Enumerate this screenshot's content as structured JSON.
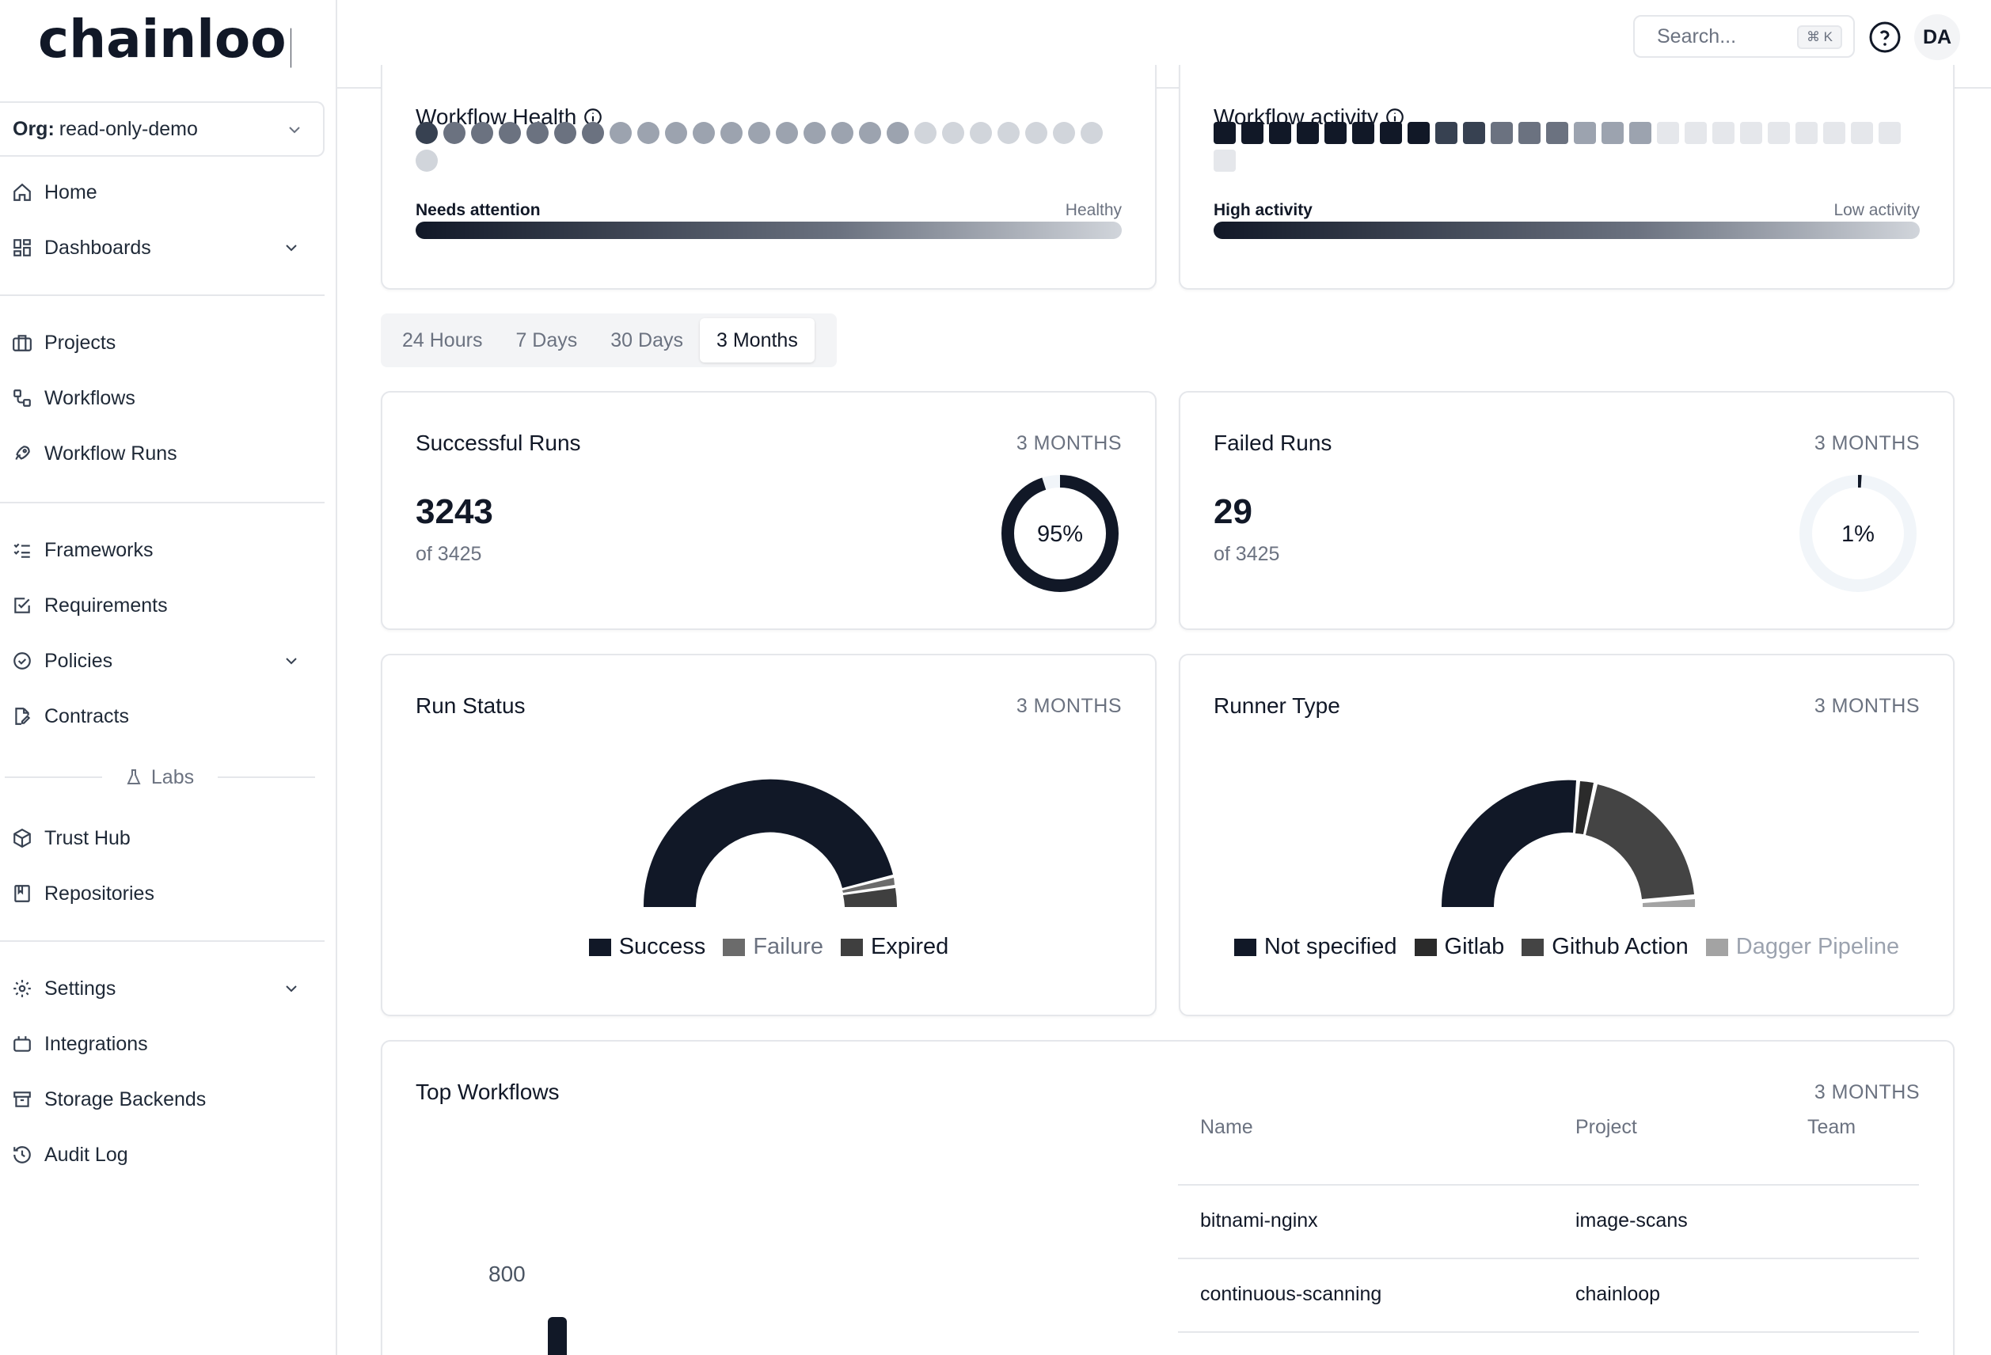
{
  "app": {
    "logo_text": "chainloop"
  },
  "sidebar": {
    "org_label": "Org:",
    "org_value": "read-only-demo",
    "items": {
      "home": "Home",
      "dashboards": "Dashboards",
      "projects": "Projects",
      "workflows": "Workflows",
      "workflow_runs": "Workflow Runs",
      "frameworks": "Frameworks",
      "requirements": "Requirements",
      "policies": "Policies",
      "contracts": "Contracts",
      "labs": "Labs",
      "trust_hub": "Trust Hub",
      "repositories": "Repositories",
      "settings": "Settings",
      "integrations": "Integrations",
      "storage_backends": "Storage Backends",
      "audit_log": "Audit Log"
    }
  },
  "topbar": {
    "search_placeholder": "Search...",
    "search_shortcut": "⌘ K",
    "avatar_initials": "DA"
  },
  "health": {
    "title": "Workflow Health",
    "low_label": "Needs attention",
    "high_label": "Healthy",
    "dot_colors": [
      "#374151",
      "#6b7280",
      "#6b7280",
      "#6b7280",
      "#6b7280",
      "#6b7280",
      "#6b7280",
      "#9ca3af",
      "#9ca3af",
      "#9ca3af",
      "#9ca3af",
      "#9ca3af",
      "#9ca3af",
      "#9ca3af",
      "#9ca3af",
      "#9ca3af",
      "#9ca3af",
      "#9ca3af",
      "#d1d5db",
      "#d1d5db",
      "#d1d5db",
      "#d1d5db",
      "#d1d5db",
      "#d1d5db",
      "#d1d5db",
      "#d1d5db"
    ]
  },
  "activity": {
    "title": "Workflow activity",
    "high_label": "High activity",
    "low_label": "Low activity",
    "square_colors": [
      "#111827",
      "#111827",
      "#111827",
      "#111827",
      "#111827",
      "#111827",
      "#111827",
      "#111827",
      "#374151",
      "#374151",
      "#6b7280",
      "#6b7280",
      "#6b7280",
      "#9ca3af",
      "#9ca3af",
      "#9ca3af",
      "#e5e7eb",
      "#e5e7eb",
      "#e5e7eb",
      "#e5e7eb",
      "#e5e7eb",
      "#e5e7eb",
      "#e5e7eb",
      "#e5e7eb",
      "#e5e7eb",
      "#e5e7eb"
    ]
  },
  "tabs": [
    "24 Hours",
    "7 Days",
    "30 Days",
    "3 Months"
  ],
  "active_tab": "3 Months",
  "successful_runs": {
    "title": "Successful Runs",
    "period": "3 MONTHS",
    "value": "3243",
    "of_text": "of 3425",
    "percent_label": "95%",
    "fraction": 0.95
  },
  "failed_runs": {
    "title": "Failed Runs",
    "period": "3 MONTHS",
    "value": "29",
    "of_text": "of 3425",
    "percent_label": "1%",
    "fraction": 0.01
  },
  "run_status": {
    "title": "Run Status",
    "period": "3 MONTHS",
    "legend": [
      {
        "name": "Success",
        "color": "#111827",
        "text_color": "#111827"
      },
      {
        "name": "Failure",
        "color": "#6b6b6b",
        "text_color": "#6b7280"
      },
      {
        "name": "Expired",
        "color": "#3f3f3f",
        "text_color": "#111827"
      }
    ]
  },
  "runner_type": {
    "title": "Runner Type",
    "period": "3 MONTHS",
    "legend": [
      {
        "name": "Not specified",
        "color": "#111827",
        "text_color": "#111827"
      },
      {
        "name": "Gitlab",
        "color": "#2b2b2b",
        "text_color": "#111827"
      },
      {
        "name": "Github Action",
        "color": "#444444",
        "text_color": "#111827"
      },
      {
        "name": "Dagger Pipeline",
        "color": "#a3a3a3",
        "text_color": "#9ca3af"
      }
    ]
  },
  "top_workflows": {
    "title": "Top Workflows",
    "period": "3 MONTHS",
    "axis_tick": "800",
    "columns": {
      "name": "Name",
      "project": "Project",
      "team": "Team"
    },
    "rows": [
      {
        "name": "bitnami-nginx",
        "project": "image-scans",
        "team": ""
      },
      {
        "name": "continuous-scanning",
        "project": "chainloop",
        "team": ""
      }
    ]
  }
}
